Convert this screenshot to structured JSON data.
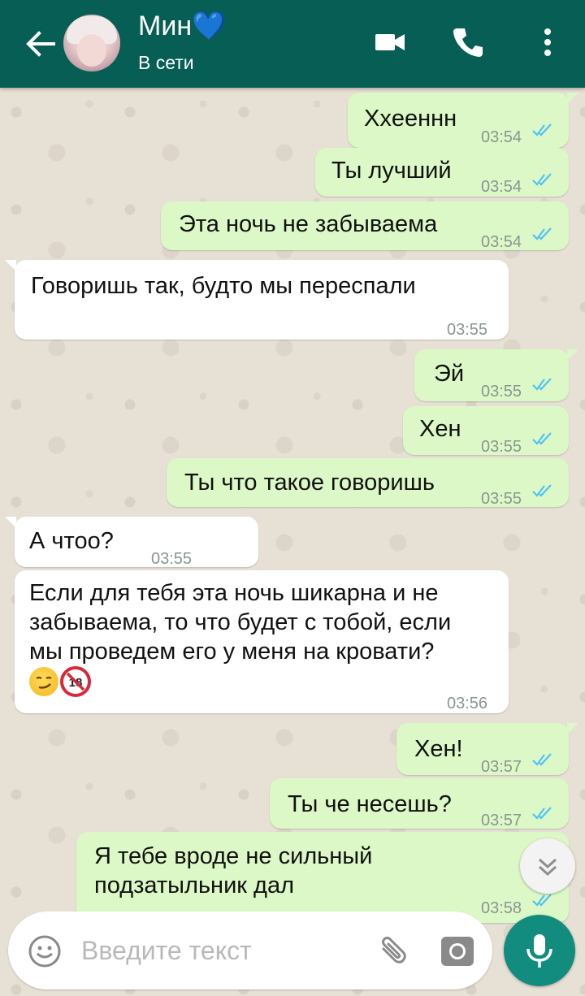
{
  "header": {
    "contact_name": "Мин",
    "name_emoji": "💙",
    "status": "В сети",
    "bg_color": "#075e54"
  },
  "messages": [
    {
      "dir": "out",
      "text": "Хxееннн",
      "time": "03:54"
    },
    {
      "dir": "out",
      "text": "Ты лучший",
      "time": "03:54"
    },
    {
      "dir": "out",
      "text": "Эта ночь не забываема",
      "time": "03:54"
    },
    {
      "dir": "in",
      "text": "Говоришь так, будто мы переспали",
      "time": "03:55"
    },
    {
      "dir": "out",
      "text": "Эй",
      "time": "03:55"
    },
    {
      "dir": "out",
      "text": "Хен",
      "time": "03:55"
    },
    {
      "dir": "out",
      "text": "Ты что такое говоришь",
      "time": "03:55"
    },
    {
      "dir": "in",
      "text": "А чтоо?",
      "time": "03:55"
    },
    {
      "dir": "in",
      "lines": [
        "Если для тебя эта ночь шикарна и не",
        "забываема, то что будет с тобой, если",
        "мы проведем его у меня на кровати?"
      ],
      "time": "03:56"
    },
    {
      "dir": "out",
      "text": "Хен!",
      "time": "03:57"
    },
    {
      "dir": "out",
      "text": "Ты че несешь?",
      "time": "03:57"
    },
    {
      "dir": "out",
      "lines": [
        "Я тебе вроде не сильный",
        "подзатыльник дал"
      ],
      "time": "03:58"
    }
  ],
  "input": {
    "placeholder": "Введите текст"
  },
  "icons": {
    "back": "back-arrow-icon",
    "video": "video-call-icon",
    "phone": "phone-call-icon",
    "menu": "more-vert-icon",
    "emoji": "emoji-icon",
    "attach": "paperclip-icon",
    "camera": "camera-icon",
    "mic": "mic-icon",
    "scroll": "chevron-double-down-icon"
  },
  "colors": {
    "outgoing_bubble": "#dcf8c6",
    "incoming_bubble": "#ffffff",
    "read_ticks": "#4fc3f7",
    "accent": "#128c7e"
  }
}
